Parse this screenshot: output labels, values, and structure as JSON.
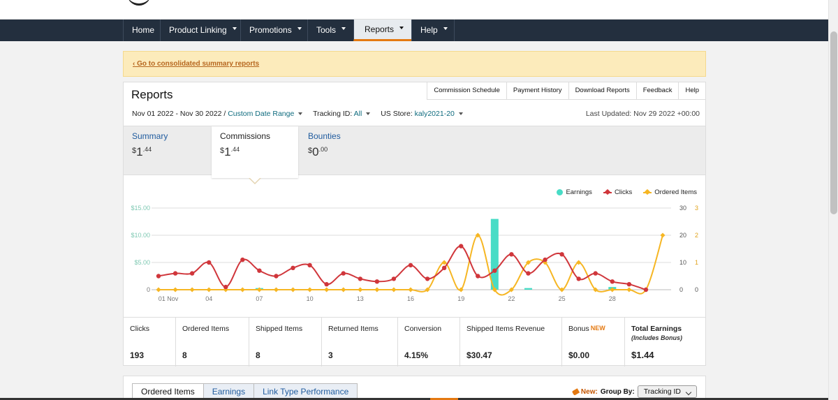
{
  "nav": {
    "items": [
      {
        "label": "Home",
        "caret": false
      },
      {
        "label": "Product Linking",
        "caret": true
      },
      {
        "label": "Promotions",
        "caret": true
      },
      {
        "label": "Tools",
        "caret": true
      },
      {
        "label": "Reports",
        "caret": true,
        "active": true
      },
      {
        "label": "Help",
        "caret": true
      }
    ]
  },
  "alert": {
    "link": "‹ Go to consolidated summary reports"
  },
  "reports": {
    "title": "Reports",
    "top_links": [
      "Commission Schedule",
      "Payment History",
      "Download Reports",
      "Feedback",
      "Help"
    ],
    "filters": {
      "date_range": "Nov 01 2022 - Nov 30 2022 /",
      "custom_range": "Custom Date Range",
      "tracking_label": "Tracking ID:",
      "tracking_value": "All",
      "store_label": "US Store:",
      "store_value": "kaly2021-20"
    },
    "last_updated": "Last Updated: Nov 29 2022 +00:00",
    "tabs": [
      {
        "label": "Summary",
        "currency": "$",
        "whole": "1",
        "cents": ".44",
        "selected": false
      },
      {
        "label": "Commissions",
        "currency": "$",
        "whole": "1",
        "cents": ".44",
        "selected": true
      },
      {
        "label": "Bounties",
        "currency": "$",
        "whole": "0",
        "cents": ".00",
        "selected": false
      }
    ]
  },
  "legend": {
    "earnings": "Earnings",
    "clicks": "Clicks",
    "ordered": "Ordered Items"
  },
  "colors": {
    "earnings": "#48dcc6",
    "clicks": "#d0363b",
    "ordered": "#f6b623",
    "nav_bg": "#232f3e",
    "accent": "#e47911"
  },
  "chart_data": {
    "type": "bar",
    "x_ticks": [
      "01 Nov",
      "04",
      "07",
      "10",
      "13",
      "16",
      "19",
      "22",
      "25",
      "28"
    ],
    "y_left_ticks": [
      "$15.00",
      "$10.00",
      "$5.00",
      "0"
    ],
    "y_right_clicks_ticks": [
      "30",
      "20",
      "10",
      "0"
    ],
    "y_right_items_ticks": [
      "3",
      "2",
      "1",
      "0"
    ],
    "ylim_earnings": [
      0,
      15
    ],
    "ylim_clicks": [
      0,
      30
    ],
    "ylim_items": [
      0,
      3
    ],
    "series": [
      {
        "name": "Earnings",
        "type": "bar",
        "values": [
          0,
          0,
          0,
          0,
          0,
          0,
          0.3,
          0,
          0,
          0,
          0,
          0,
          0,
          0,
          0,
          0,
          0,
          0,
          0,
          0,
          13,
          0,
          0.3,
          0,
          0,
          0,
          0,
          0.5,
          0
        ]
      },
      {
        "name": "Clicks",
        "type": "line",
        "values": [
          5,
          6,
          6,
          10,
          1,
          11,
          7,
          5,
          8,
          9,
          2,
          6,
          4,
          3,
          4,
          9,
          4,
          8,
          16,
          5,
          7,
          13,
          6,
          11,
          13,
          4,
          6,
          3,
          2,
          0
        ]
      },
      {
        "name": "Ordered Items",
        "type": "line",
        "values": [
          0,
          0,
          0,
          0,
          0,
          0,
          0,
          0,
          0,
          0,
          0,
          0,
          0,
          0,
          0,
          0,
          0,
          1,
          0,
          2,
          0,
          0,
          1,
          1,
          0,
          1,
          0,
          0,
          0,
          0,
          2
        ]
      }
    ]
  },
  "stats": [
    {
      "label": "Clicks",
      "value": "193"
    },
    {
      "label": "Ordered Items",
      "value": "8"
    },
    {
      "label": "Shipped Items",
      "value": "8"
    },
    {
      "label": "Returned Items",
      "value": "3"
    },
    {
      "label": "Conversion",
      "value": "4.15%"
    },
    {
      "label": "Shipped Items Revenue",
      "value": "$30.47"
    },
    {
      "label": "Bonus",
      "badge": "NEW",
      "value": "$0.00"
    },
    {
      "label": "Total Earnings",
      "sub": "(Includes Bonus)",
      "value": "$1.44"
    }
  ],
  "bottom": {
    "tabs": [
      "Ordered Items",
      "Earnings",
      "Link Type Performance"
    ],
    "new_label": "New:",
    "group_by_label": "Group By:",
    "group_by_value": "Tracking ID"
  }
}
